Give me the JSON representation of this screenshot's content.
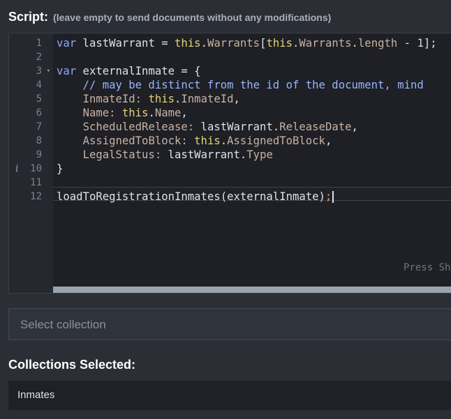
{
  "script": {
    "label": "Script:",
    "hint": "(leave empty to send documents without any modifications)",
    "press_hint": "Press Sh",
    "gutter_info_icon": "info-icon",
    "lines": [
      {
        "no": "1"
      },
      {
        "no": "2"
      },
      {
        "no": "3"
      },
      {
        "no": "4"
      },
      {
        "no": "5"
      },
      {
        "no": "6"
      },
      {
        "no": "7"
      },
      {
        "no": "8"
      },
      {
        "no": "9"
      },
      {
        "no": "10"
      },
      {
        "no": "11"
      },
      {
        "no": "12"
      }
    ],
    "tokens": {
      "l1": [
        "var",
        " lastWarrant ",
        "=",
        " ",
        "this",
        ".",
        "Warrants",
        "[",
        "this",
        ".",
        "Warrants",
        ".",
        "length",
        " ",
        "-",
        " ",
        "1",
        "];"
      ],
      "l3": [
        "var",
        " externalInmate ",
        "=",
        " {"
      ],
      "l4": "    // may be distinct from the id of the document, mind",
      "l5": [
        "    ",
        "InmateId:",
        " ",
        "this",
        ".",
        "InmateId",
        ","
      ],
      "l6": [
        "    ",
        "Name:",
        " ",
        "this",
        ".",
        "Name",
        ","
      ],
      "l7": [
        "    ",
        "ScheduledRelease:",
        " lastWarrant",
        ".",
        "ReleaseDate",
        ","
      ],
      "l8": [
        "    ",
        "AssignedToBlock:",
        " ",
        "this",
        ".",
        "AssignedToBlock",
        ","
      ],
      "l9": [
        "    ",
        "LegalStatus:",
        " lastWarrant",
        ".",
        "Type"
      ],
      "l10": "}",
      "l12": [
        "loadToRegistrationInmates(externalInmate)",
        ";"
      ]
    }
  },
  "collection_select": {
    "placeholder": "Select collection"
  },
  "collections_selected": {
    "label": "Collections Selected:",
    "items": [
      "Inmates"
    ]
  }
}
